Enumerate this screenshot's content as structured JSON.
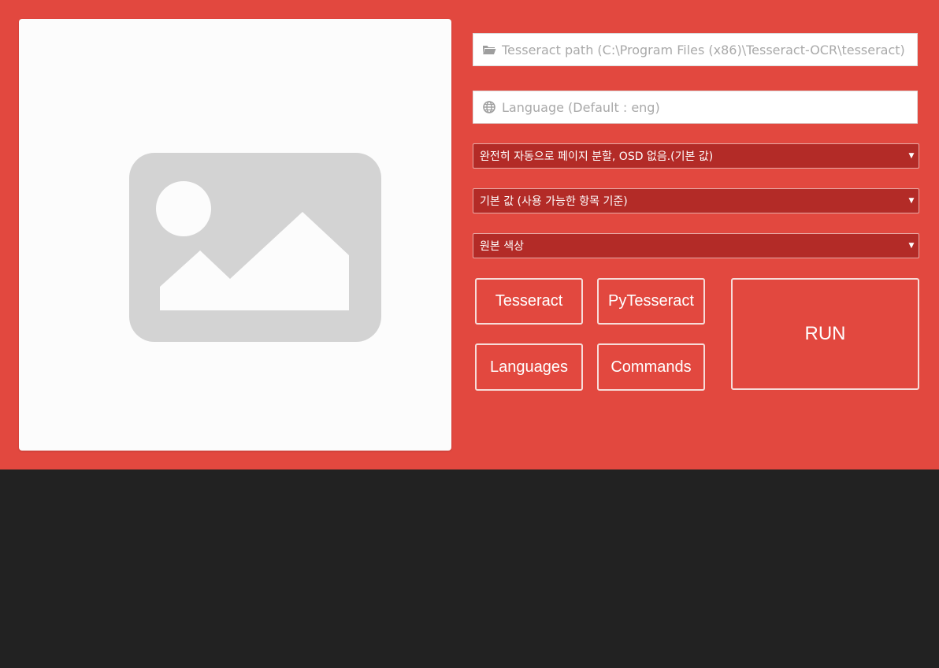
{
  "colors": {
    "panel_background": "#e2483f",
    "page_background": "#222222",
    "select_background": "#b32b27",
    "card_background": "#fcfcfc",
    "placeholder_graphic": "#d3d3d3"
  },
  "image_preview": {
    "icon": "image-placeholder-icon"
  },
  "path_field": {
    "icon": "folder-open-icon",
    "placeholder": "Tesseract path (C:\\Program Files (x86)\\Tesseract-OCR\\tesseract)",
    "value": ""
  },
  "language_field": {
    "icon": "globe-icon",
    "placeholder": "Language (Default : eng)",
    "value": ""
  },
  "selects": {
    "psm": {
      "selected": "완전히 자동으로 페이지 분할, OSD 없음.(기본 값)"
    },
    "oem": {
      "selected": "기본 값 (사용 가능한 항목 기준)"
    },
    "color": {
      "selected": "원본 색상"
    }
  },
  "buttons": {
    "tesseract": "Tesseract",
    "pytesseract": "PyTesseract",
    "languages": "Languages",
    "commands": "Commands",
    "run": "RUN"
  }
}
